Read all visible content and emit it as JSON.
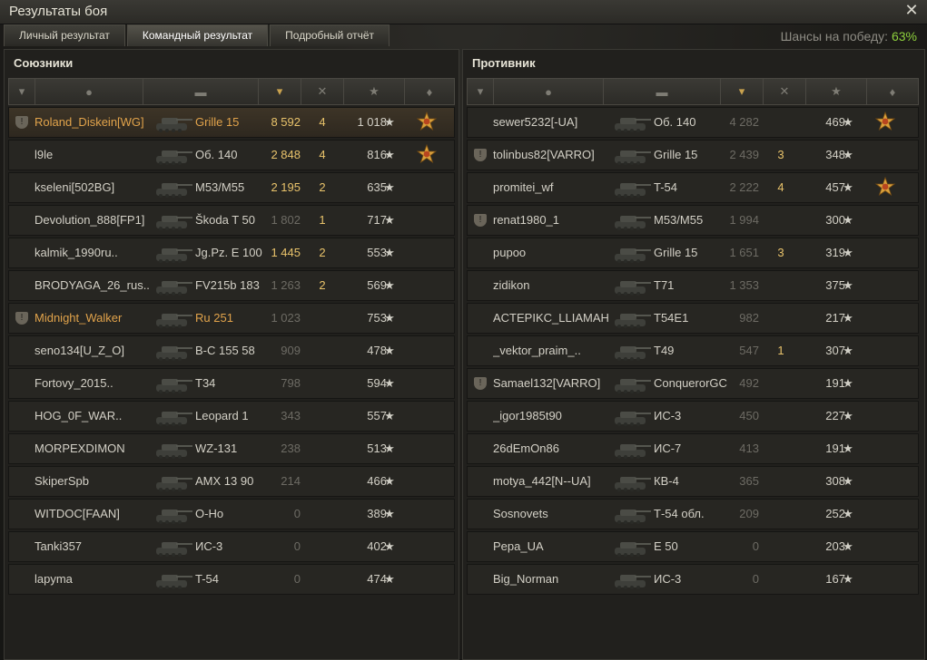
{
  "window": {
    "title": "Результаты боя"
  },
  "tabs": [
    {
      "label": "Личный результат",
      "active": false
    },
    {
      "label": "Командный результат",
      "active": true
    },
    {
      "label": "Подробный отчёт",
      "active": false
    }
  ],
  "win_chance": {
    "label": "Шансы на победу:",
    "value": "63%"
  },
  "allies": {
    "title": "Союзники",
    "rows": [
      {
        "name": "Roland_Diskein[WG]",
        "vehicle": "Grille 15",
        "damage": "8 592",
        "kills": "4",
        "xp": "1 018",
        "clan": true,
        "medal": true,
        "medal_count": "2",
        "style": "self"
      },
      {
        "name": "l9le",
        "vehicle": "Об. 140",
        "damage": "2 848",
        "kills": "4",
        "xp": "816",
        "clan": false,
        "medal": true,
        "style": "normal"
      },
      {
        "name": "kseleni[502BG]",
        "vehicle": "M53/M55",
        "damage": "2 195",
        "kills": "2",
        "xp": "635",
        "clan": false,
        "medal": false,
        "style": "normal"
      },
      {
        "name": "Devolution_888[FP1]",
        "vehicle": "Škoda T 50",
        "damage": "1 802",
        "kills": "1",
        "xp": "717",
        "clan": false,
        "medal": false,
        "style": "dead"
      },
      {
        "name": "kalmik_1990ru..",
        "vehicle": "Jg.Pz. E 100",
        "damage": "1 445",
        "kills": "2",
        "xp": "553",
        "clan": false,
        "medal": false,
        "style": "normal"
      },
      {
        "name": "BRODYAGA_26_rus..",
        "vehicle": "FV215b 183",
        "damage": "1 263",
        "kills": "2",
        "xp": "569",
        "clan": false,
        "medal": false,
        "style": "dead"
      },
      {
        "name": "Midnight_Walker",
        "vehicle": "Ru 251",
        "damage": "1 023",
        "kills": "",
        "xp": "753",
        "clan": true,
        "medal": false,
        "style": "platoon"
      },
      {
        "name": "seno134[U_Z_O]",
        "vehicle": "B-C 155 58",
        "damage": "909",
        "kills": "",
        "xp": "478",
        "clan": false,
        "medal": false,
        "style": "dead"
      },
      {
        "name": "Fortovy_2015..",
        "vehicle": "T34",
        "damage": "798",
        "kills": "",
        "xp": "594",
        "clan": false,
        "medal": false,
        "style": "dead"
      },
      {
        "name": "HOG_0F_WAR..",
        "vehicle": "Leopard 1",
        "damage": "343",
        "kills": "",
        "xp": "557",
        "clan": false,
        "medal": false,
        "style": "dead"
      },
      {
        "name": "MORPEXDIMON",
        "vehicle": "WZ-131",
        "damage": "238",
        "kills": "",
        "xp": "513",
        "clan": false,
        "medal": false,
        "style": "dead"
      },
      {
        "name": "SkiperSpb",
        "vehicle": "AMX 13 90",
        "damage": "214",
        "kills": "",
        "xp": "466",
        "clan": false,
        "medal": false,
        "style": "dead"
      },
      {
        "name": "WITDOC[FAAN]",
        "vehicle": "O-Ho",
        "damage": "0",
        "kills": "",
        "xp": "389",
        "clan": false,
        "medal": false,
        "style": "dead"
      },
      {
        "name": "Tanki357",
        "vehicle": "ИС-3",
        "damage": "0",
        "kills": "",
        "xp": "402",
        "clan": false,
        "medal": false,
        "style": "dead"
      },
      {
        "name": "lapyma",
        "vehicle": "T-54",
        "damage": "0",
        "kills": "",
        "xp": "474",
        "clan": false,
        "medal": false,
        "style": "dead"
      }
    ]
  },
  "enemies": {
    "title": "Противник",
    "rows": [
      {
        "name": "sewer5232[-UA]",
        "vehicle": "Об. 140",
        "damage": "4 282",
        "kills": "",
        "xp": "469",
        "clan": false,
        "medal": true,
        "style": "dead"
      },
      {
        "name": "tolinbus82[VARRO]",
        "vehicle": "Grille 15",
        "damage": "2 439",
        "kills": "3",
        "xp": "348",
        "clan": true,
        "medal": false,
        "style": "dead"
      },
      {
        "name": "promitei_wf",
        "vehicle": "T-54",
        "damage": "2 222",
        "kills": "4",
        "xp": "457",
        "clan": false,
        "medal": true,
        "style": "dead"
      },
      {
        "name": "renat1980_1",
        "vehicle": "M53/M55",
        "damage": "1 994",
        "kills": "",
        "xp": "300",
        "clan": true,
        "medal": false,
        "style": "dead"
      },
      {
        "name": "pupoo",
        "vehicle": "Grille 15",
        "damage": "1 651",
        "kills": "3",
        "xp": "319",
        "clan": false,
        "medal": false,
        "style": "dead"
      },
      {
        "name": "zidikon",
        "vehicle": "T71",
        "damage": "1 353",
        "kills": "",
        "xp": "375",
        "clan": false,
        "medal": false,
        "style": "dead"
      },
      {
        "name": "ACTEPIKC_LLIAMAH",
        "vehicle": "T54E1",
        "damage": "982",
        "kills": "",
        "xp": "217",
        "clan": false,
        "medal": false,
        "style": "dead"
      },
      {
        "name": "_vektor_praim_..",
        "vehicle": "T49",
        "damage": "547",
        "kills": "1",
        "xp": "307",
        "clan": false,
        "medal": false,
        "style": "dead"
      },
      {
        "name": "Samael132[VARRO]",
        "vehicle": "ConquerorGC",
        "damage": "492",
        "kills": "",
        "xp": "191",
        "clan": true,
        "medal": false,
        "style": "dead"
      },
      {
        "name": "_igor1985t90",
        "vehicle": "ИС-3",
        "damage": "450",
        "kills": "",
        "xp": "227",
        "clan": false,
        "medal": false,
        "style": "dead"
      },
      {
        "name": "26dEmOn86",
        "vehicle": "ИС-7",
        "damage": "413",
        "kills": "",
        "xp": "191",
        "clan": false,
        "medal": false,
        "style": "dead"
      },
      {
        "name": "motya_442[N--UA]",
        "vehicle": "КВ-4",
        "damage": "365",
        "kills": "",
        "xp": "308",
        "clan": false,
        "medal": false,
        "style": "dead"
      },
      {
        "name": "Sosnovets",
        "vehicle": "Т-54 обл.",
        "damage": "209",
        "kills": "",
        "xp": "252",
        "clan": false,
        "medal": false,
        "style": "dead"
      },
      {
        "name": "Pepa_UA",
        "vehicle": "E 50",
        "damage": "0",
        "kills": "",
        "xp": "203",
        "clan": false,
        "medal": false,
        "style": "dead"
      },
      {
        "name": "Big_Norman",
        "vehicle": "ИС-3",
        "damage": "0",
        "kills": "",
        "xp": "167",
        "clan": false,
        "medal": false,
        "style": "dead"
      }
    ]
  },
  "icons": {
    "close": "close-icon",
    "star": "★",
    "clan": "clan-shield-icon",
    "medal": "medal-icon"
  },
  "colors": {
    "self_name": "#e1a34b",
    "damage_gold": "#e9c36b",
    "win_chance": "#8ed13d"
  }
}
